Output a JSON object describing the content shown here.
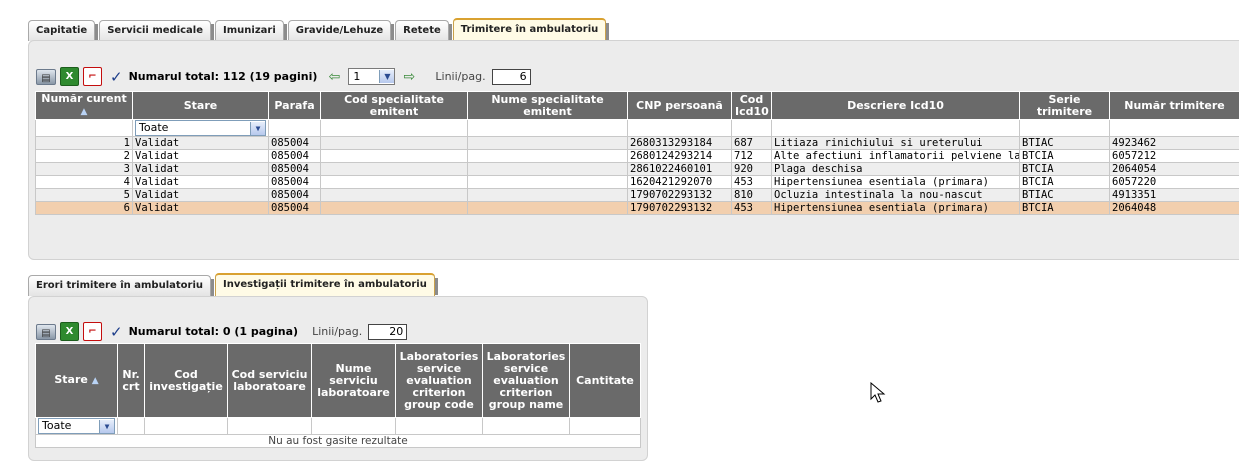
{
  "top_tabs": [
    "Capitatie",
    "Servicii medicale",
    "Imunizari",
    "Gravide/Lehuze",
    "Retete",
    "Trimitere în ambulatoriu"
  ],
  "top_active_tab": 5,
  "top_toolbar": {
    "total_text": "Numarul total: 112 (19 pagini)",
    "page_value": "1",
    "rows_label": "Linii/pag.",
    "rows_value": "6"
  },
  "top_table": {
    "headers": [
      "Număr curent",
      "Stare",
      "Parafa",
      "Cod specialitate emitent",
      "Nume specialitate emitent",
      "CNP persoană",
      "Cod Icd10",
      "Descriere Icd10",
      "Serie trimitere",
      "Număr trimitere"
    ],
    "filter_value": "Toate",
    "rows": [
      [
        "1",
        "Validat",
        "085004",
        "",
        "",
        "2680313293184",
        "687",
        "Litiaza rinichiului si ureterului",
        "BTIAC",
        "4923462"
      ],
      [
        "2",
        "Validat",
        "085004",
        "",
        "",
        "2680124293214",
        "712",
        "Alte afectiuni inflamatorii pelviene la femeie",
        "BTCIA",
        "6057212"
      ],
      [
        "3",
        "Validat",
        "085004",
        "",
        "",
        "2861022460101",
        "920",
        "Plaga deschisa",
        "BTCIA",
        "2064054"
      ],
      [
        "4",
        "Validat",
        "085004",
        "",
        "",
        "1620421292070",
        "453",
        "Hipertensiunea esentiala (primara)",
        "BTCIA",
        "6057220"
      ],
      [
        "5",
        "Validat",
        "085004",
        "",
        "",
        "1790702293132",
        "810",
        "Ocluzia intestinala la nou-nascut",
        "BTIAC",
        "4913351"
      ],
      [
        "6",
        "Validat",
        "085004",
        "",
        "",
        "1790702293132",
        "453",
        "Hipertensiunea esentiala (primara)",
        "BTCIA",
        "2064048"
      ]
    ]
  },
  "bottom_tabs": [
    "Erori trimitere în ambulatoriu",
    "Investigații trimitere în ambulatoriu"
  ],
  "bottom_active_tab": 1,
  "bottom_toolbar": {
    "total_text": "Numarul total: 0 (1 pagina)",
    "rows_label": "Linii/pag.",
    "rows_value": "20"
  },
  "bottom_table": {
    "headers": [
      "Stare",
      "Nr. crt",
      "Cod investigație",
      "Cod serviciu laboratoare",
      "Nume serviciu laboratoare",
      "Laboratories service evaluation criterion group code",
      "Laboratories service evaluation criterion group name",
      "Cantitate"
    ],
    "filter_value": "Toate",
    "empty_text": "Nu au fost gasite rezultate"
  },
  "colors": {
    "header_bg": "#6a6a6a",
    "selected_row": "#f2cfae",
    "active_tab_border": "#d9a130"
  }
}
